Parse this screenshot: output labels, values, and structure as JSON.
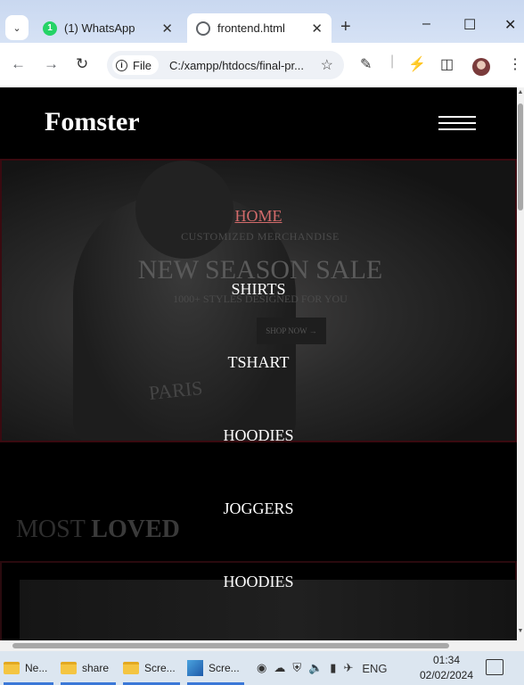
{
  "browser": {
    "tabs": [
      {
        "title": "(1) WhatsApp",
        "badge": "1",
        "close": "✕"
      },
      {
        "title": "frontend.html",
        "close": "✕"
      }
    ],
    "new_tab": "+",
    "window": {
      "minimize": "–",
      "maximize": "☐",
      "close": "✕"
    },
    "address": {
      "chip": "File",
      "url": "C:/xampp/htdocs/final-pr..."
    }
  },
  "site": {
    "logo": "Fomster",
    "menu": [
      "HOME",
      "SHIRTS",
      "TSHART",
      "HOODIES",
      "JOGGERS",
      "HOODIES"
    ],
    "hero": {
      "subtitle": "CUSTOMIZED MERCHANDISE",
      "title": "NEW SEASON SALE",
      "description": "1000+ STYLES DESIGNED FOR YOU",
      "button": "SHOP NOW →",
      "image_text": "PARIS"
    },
    "section": {
      "title_light": "MOST",
      "title_bold": "LOVED"
    }
  },
  "taskbar": {
    "apps": [
      {
        "label": "Ne..."
      },
      {
        "label": "share"
      },
      {
        "label": "Scre..."
      },
      {
        "label": "Scre..."
      }
    ],
    "language": "ENG",
    "time": "01:34",
    "date": "02/02/2024"
  },
  "colors": {
    "active_menu": "#d36b6b",
    "tab_strip": "#d3e3fd",
    "page_bg": "#000000"
  }
}
